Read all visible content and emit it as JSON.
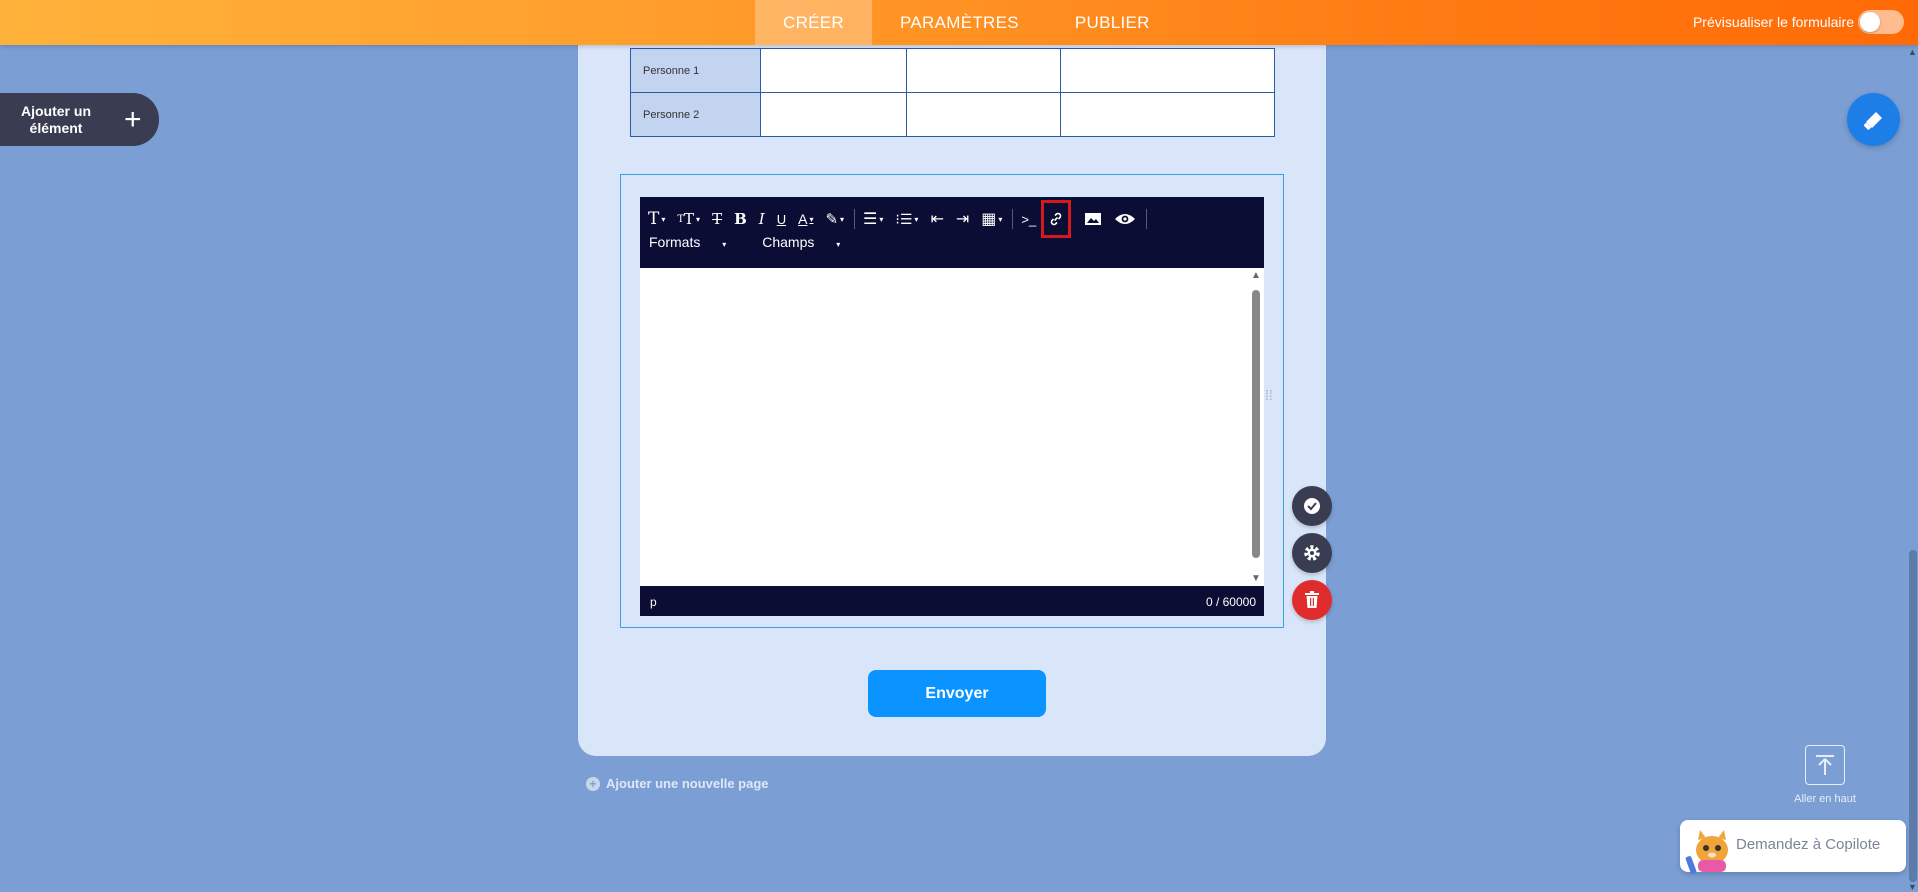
{
  "topbar": {
    "tabs": [
      {
        "label": "CRÉER",
        "active": true
      },
      {
        "label": "PARAMÈTRES",
        "active": false
      },
      {
        "label": "PUBLIER",
        "active": false
      }
    ],
    "preview_label": "Prévisualiser le formulaire",
    "preview_toggle_on": false
  },
  "add_element": {
    "label": "Ajouter un élément",
    "icon": "plus-icon"
  },
  "table": {
    "rows": [
      {
        "label": "Personne 1"
      },
      {
        "label": "Personne 2"
      }
    ]
  },
  "editor": {
    "row2": {
      "formats": "Formats",
      "champs": "Champs"
    },
    "status_path": "p",
    "char_count": "0 / 60000"
  },
  "buttons": {
    "send": "Envoyer",
    "new_page": "Ajouter une nouvelle page"
  },
  "scroll_top": {
    "label": "Aller en haut"
  },
  "copilot": {
    "label": "Demandez à Copilote"
  },
  "colors": {
    "accent_orange": "#ff7a12",
    "primary_blue": "#0b93ff",
    "toolbar": "#0b0d35",
    "danger": "#e02c2c"
  }
}
